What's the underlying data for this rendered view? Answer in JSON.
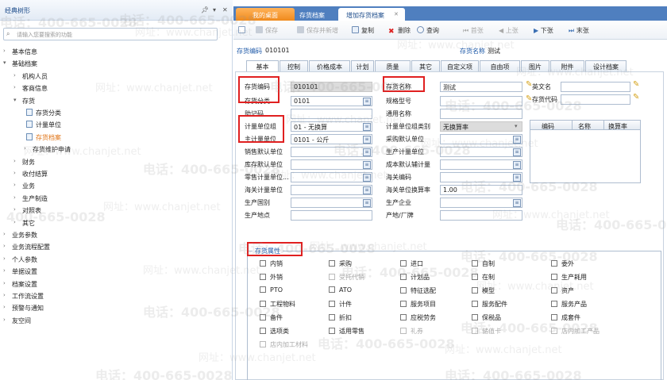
{
  "left_panel": {
    "title": "经典树形",
    "pin_icon": "pin-icon",
    "menu_icon": "menu-icon",
    "close_icon": "close-icon",
    "search_placeholder": "请输入您要搜索的功能",
    "tree": [
      {
        "label": "基本信息",
        "level": 0,
        "expanded": false
      },
      {
        "label": "基础档案",
        "level": 0,
        "expanded": true
      },
      {
        "label": "机构人员",
        "level": 1,
        "expanded": false
      },
      {
        "label": "客商信息",
        "level": 1,
        "expanded": false
      },
      {
        "label": "存货",
        "level": 1,
        "expanded": true
      },
      {
        "label": "存货分类",
        "level": 2,
        "leaf": true
      },
      {
        "label": "计量单位",
        "level": 2,
        "leaf": true
      },
      {
        "label": "存货档案",
        "level": 2,
        "leaf": true,
        "selected": true
      },
      {
        "label": "存货维护申请",
        "level": 2,
        "expanded": false
      },
      {
        "label": "财务",
        "level": 1,
        "expanded": false
      },
      {
        "label": "收付结算",
        "level": 1,
        "expanded": false
      },
      {
        "label": "业务",
        "level": 1,
        "expanded": false
      },
      {
        "label": "生产制造",
        "level": 1,
        "expanded": false
      },
      {
        "label": "对照表",
        "level": 1,
        "expanded": false
      },
      {
        "label": "其它",
        "level": 1,
        "expanded": false
      },
      {
        "label": "业务参数",
        "level": 0,
        "expanded": false
      },
      {
        "label": "业务流程配置",
        "level": 0,
        "expanded": false
      },
      {
        "label": "个人参数",
        "level": 0,
        "expanded": false
      },
      {
        "label": "单据设置",
        "level": 0,
        "expanded": false
      },
      {
        "label": "档案设置",
        "level": 0,
        "expanded": false
      },
      {
        "label": "工作流设置",
        "level": 0,
        "expanded": false
      },
      {
        "label": "预警与通知",
        "level": 0,
        "expanded": false
      },
      {
        "label": "友空间",
        "level": 0,
        "expanded": false
      }
    ]
  },
  "page_tabs": {
    "desktop": "我的桌面",
    "archive": "存货档案",
    "add": "增加存货档案",
    "close_icon": "close-icon"
  },
  "toolbar": {
    "new": "",
    "save": "保存",
    "save_new": "保存并新增",
    "copy": "复制",
    "delete": "删除",
    "query": "查询",
    "first": "首张",
    "prev": "上张",
    "next": "下张",
    "last": "末张"
  },
  "header": {
    "code_label": "存货编码",
    "code_value": "010101",
    "name_label": "存货名称",
    "name_value": "测试"
  },
  "form_tabs": [
    "基本",
    "控制",
    "价格成本",
    "计划",
    "质量",
    "其它",
    "自定义项",
    "自由项",
    "图片",
    "附件",
    "设计档案"
  ],
  "fields_left": [
    {
      "label": "存货编码",
      "value": "010101",
      "gray": true,
      "highlight": true
    },
    {
      "label": "存货分类",
      "value": "0101",
      "picker": true,
      "highlight": true
    },
    {
      "label": "助记码",
      "value": ""
    },
    {
      "label": "计量单位组",
      "value": "01 - 无换算",
      "picker": true,
      "highlight": true
    },
    {
      "label": "主计量单位",
      "value": "0101 - 公斤",
      "picker": true,
      "highlight": true
    },
    {
      "label": "销售默认单位",
      "value": "",
      "picker": true
    },
    {
      "label": "库存默认单位",
      "value": "",
      "picker": true
    },
    {
      "label": "零售计量单位...",
      "value": "",
      "picker": true
    },
    {
      "label": "海关计量单位",
      "value": "",
      "picker": true
    },
    {
      "label": "生产国别",
      "value": "",
      "picker": true
    },
    {
      "label": "生产地点",
      "value": ""
    }
  ],
  "fields_mid": [
    {
      "label": "存货名称",
      "value": "测试",
      "pen": true,
      "highlight": true
    },
    {
      "label": "规格型号",
      "value": "",
      "pen": true
    },
    {
      "label": "通用名称",
      "value": ""
    },
    {
      "label": "计量单位组类别",
      "value": "无换算率",
      "gray": true,
      "dropdown": true
    },
    {
      "label": "采购默认单位",
      "value": "",
      "picker": true
    },
    {
      "label": "生产计量单位",
      "value": "",
      "picker": true
    },
    {
      "label": "成本默认辅计量",
      "value": "",
      "picker": true
    },
    {
      "label": "海关编码",
      "value": "",
      "picker": true
    },
    {
      "label": "海关单位换算率",
      "value": "1.00"
    },
    {
      "label": "生产企业",
      "value": "",
      "picker": true
    },
    {
      "label": "产地/厂牌",
      "value": ""
    }
  ],
  "fields_right": [
    {
      "label": "英文名",
      "value": "",
      "pen": true
    },
    {
      "label": "存货代码",
      "value": "",
      "pen": true
    }
  ],
  "grid_headers": [
    "编码",
    "名称",
    "换算率"
  ],
  "attributes": {
    "title": "存货属性",
    "items": [
      [
        "内销",
        "采购",
        "进口",
        "自制",
        "委外"
      ],
      [
        "外销",
        "受托代销",
        "计划品",
        "在制",
        "生产耗用"
      ],
      [
        "PTO",
        "ATO",
        "特征选配",
        "模型",
        "资产"
      ],
      [
        "工程物料",
        "计件",
        "服务项目",
        "服务配件",
        "服务产品"
      ],
      [
        "备件",
        "折扣",
        "应税劳务",
        "保税品",
        "成套件"
      ],
      [
        "选项类",
        "适用零售",
        "礼券",
        "储值卡",
        "店内加工产品"
      ],
      [
        "店内加工材料"
      ]
    ],
    "disabled": [
      "受托代销",
      "礼券",
      "储值卡",
      "店内加工产品",
      "店内加工材料"
    ]
  },
  "watermark": {
    "phone": "电话：400-665-0028",
    "site": "网址：www.chanjet.net"
  }
}
